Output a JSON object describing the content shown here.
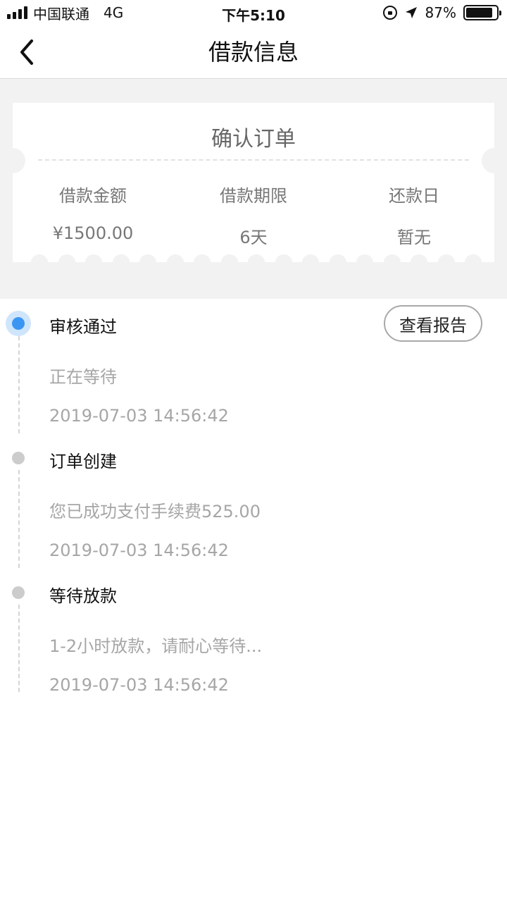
{
  "status_bar": {
    "carrier": "中国联通",
    "network": "4G",
    "time": "下午5:10",
    "battery": "87%",
    "battery_level": 0.87
  },
  "nav": {
    "title": "借款信息",
    "back_icon": "chevron-left-icon"
  },
  "summary": {
    "title": "确认订单",
    "columns": [
      {
        "label": "借款金额",
        "value": "¥1500.00"
      },
      {
        "label": "借款期限",
        "value": "6天"
      },
      {
        "label": "还款日",
        "value": "暂无"
      }
    ]
  },
  "timeline": {
    "items": [
      {
        "title": "审核通过",
        "desc": "正在等待",
        "time": "2019-07-03 14:56:42",
        "active": true
      },
      {
        "title": "订单创建",
        "desc": "您已成功支付手续费525.00",
        "time": "2019-07-03 14:56:42",
        "active": false
      },
      {
        "title": "等待放款",
        "desc": "1-2小时放款，请耐心等待...",
        "time": "2019-07-03 14:56:42",
        "active": false
      }
    ],
    "report_button_label": "查看报告"
  },
  "colors": {
    "accent": "#3b96f3",
    "accent_halo": "#cfe5fb",
    "inactive_dot": "#cccccc",
    "muted_text": "#a6a6a6",
    "band_background": "#f2f2f2"
  }
}
